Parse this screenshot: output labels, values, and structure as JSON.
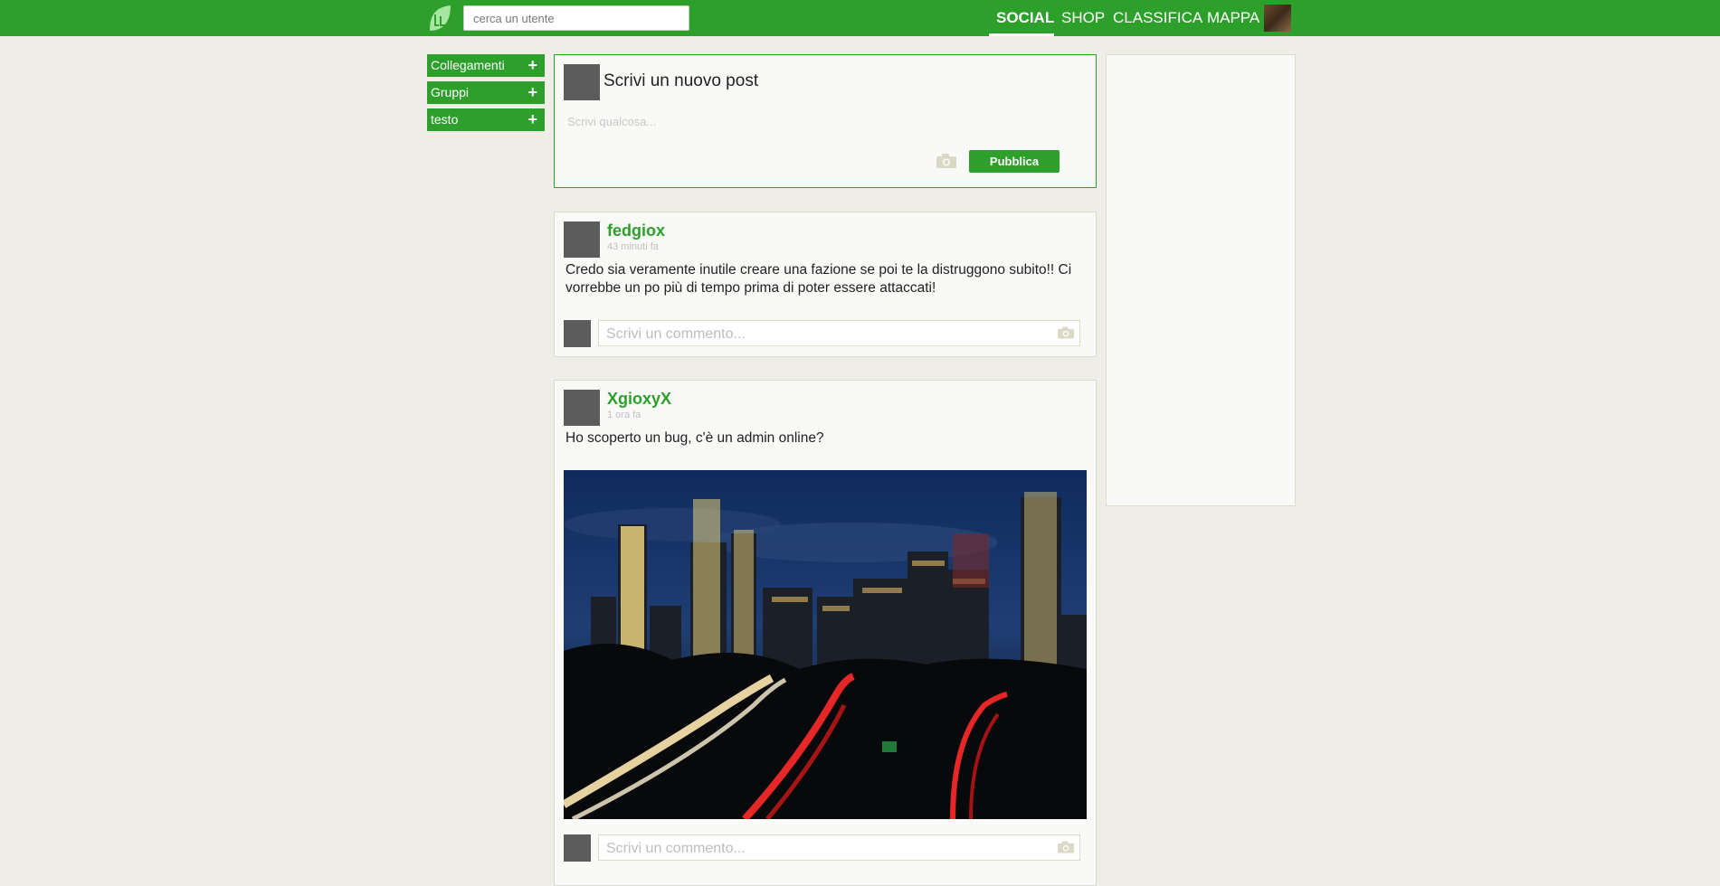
{
  "header": {
    "search_placeholder": "cerca un utente",
    "nav": [
      "SOCIAL",
      "SHOP",
      "CLASSIFICA",
      "MAPPA"
    ],
    "active_tab": "SOCIAL"
  },
  "sidebar": {
    "items": [
      {
        "label": "Collegamenti",
        "action": "+"
      },
      {
        "label": "Gruppi",
        "action": "+"
      },
      {
        "label": "testo",
        "action": "+"
      }
    ]
  },
  "composer": {
    "title": "Scrivi un nuovo post",
    "placeholder": "Scrivi qualcosa...",
    "publish_label": "Pubblica"
  },
  "posts": [
    {
      "author": "fedgiox",
      "time": "43 minuti fa",
      "text": "Credo sia veramente inutile creare una fazione se poi te la distruggono subito!! Ci vorrebbe un po più di tempo prima di poter essere attaccati!",
      "comment_placeholder": "Scrivi un commento..."
    },
    {
      "author": "XgioxyX",
      "time": "1 ora fa",
      "text": "Ho scoperto un bug, c'è un admin online?",
      "comment_placeholder": "Scrivi un commento..."
    }
  ],
  "colors": {
    "accent": "#2da02b",
    "background": "#eeeee6"
  },
  "icons": [
    "leaf-logo-icon",
    "plus-icon",
    "camera-icon"
  ]
}
